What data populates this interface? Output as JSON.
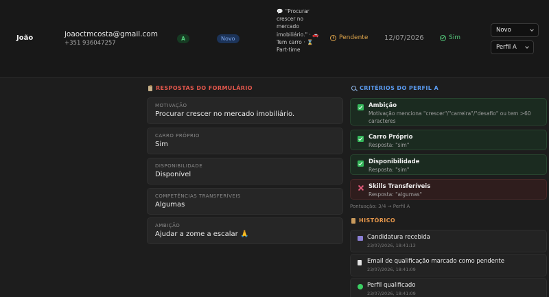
{
  "candidate": {
    "name": "João",
    "email": "joaoctmcosta@gmail.com",
    "phone": "+351 936047257",
    "profile_badge": "A",
    "status_badge": "Novo",
    "summary": {
      "quote": "\"Procurar crescer no mercado imobiliário.\"",
      "separator": "·",
      "car": "Tem carro",
      "availability": "Part-time"
    },
    "qualification": "Pendente",
    "date": "12/07/2026",
    "confirmed": "Sim",
    "status_select": "Novo",
    "profile_select": "Perfil A"
  },
  "form": {
    "title": "RESPOSTAS DO FORMULÁRIO",
    "fields": [
      {
        "label": "MOTIVAÇÃO",
        "value": "Procurar crescer no mercado imobiliário."
      },
      {
        "label": "CARRO PRÓPRIO",
        "value": "Sim"
      },
      {
        "label": "DISPONIBILIDADE",
        "value": "Disponível"
      },
      {
        "label": "COMPETÊNCIAS TRANSFERÍVEIS",
        "value": "Algumas"
      },
      {
        "label": "AMBIÇÃO",
        "value": "Ajudar a zome a escalar 🙏"
      }
    ]
  },
  "criteria": {
    "title": "CRITÉRIOS DO PERFIL A",
    "items": [
      {
        "title": "Ambição",
        "detail": "Motivação menciona \"crescer\"/\"carreira\"/\"desafio\" ou tem >60 caracteres",
        "passed": true
      },
      {
        "title": "Carro Próprio",
        "detail": "Resposta: \"sim\"",
        "passed": true
      },
      {
        "title": "Disponibilidade",
        "detail": "Resposta: \"sim\"",
        "passed": true
      },
      {
        "title": "Skills Transferíveis",
        "detail": "Resposta: \"algumas\"",
        "passed": false
      }
    ],
    "score": "Pontuação: 3/4 → Perfil A"
  },
  "history": {
    "title": "HISTÓRICO",
    "items": [
      {
        "title": "Candidatura recebida",
        "date": "23/07/2026, 18:41:13",
        "icon": "inbox-icon"
      },
      {
        "title": "Email de qualificação marcado como pendente",
        "date": "23/07/2026, 18:41:09",
        "icon": "document-icon"
      },
      {
        "title": "Perfil qualificado",
        "date": "23/07/2026, 18:41:09",
        "icon": "green-dot-icon"
      }
    ]
  },
  "colors": {
    "background": "#1d1d1d",
    "pending": "#e0a64b",
    "success": "#54c77a",
    "form_title": "#e2574c",
    "criteria_title": "#5b9bf0",
    "history_title": "#e3954a"
  }
}
